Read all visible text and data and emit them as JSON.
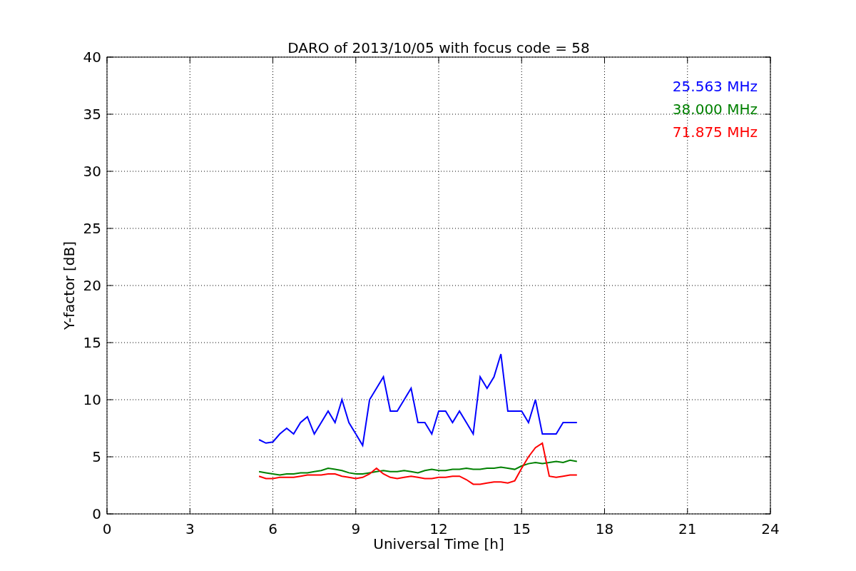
{
  "chart_data": {
    "type": "line",
    "title": "DARO of 2013/10/05 with focus code = 58",
    "xlabel": "Universal Time [h]",
    "ylabel": "Y-factor [dB]",
    "x": [
      5.5,
      5.75,
      6,
      6.25,
      6.5,
      6.75,
      7,
      7.25,
      7.5,
      7.75,
      8,
      8.25,
      8.5,
      8.75,
      9,
      9.25,
      9.5,
      9.75,
      10,
      10.25,
      10.5,
      10.75,
      11,
      11.25,
      11.5,
      11.75,
      12,
      12.25,
      12.5,
      12.75,
      13,
      13.25,
      13.5,
      13.75,
      14,
      14.25,
      14.5,
      14.75,
      15,
      15.25,
      15.5,
      15.75,
      16,
      16.25,
      16.5,
      16.75,
      17
    ],
    "series": [
      {
        "name": "25.563 MHz",
        "color": "#0000ff",
        "values": [
          6.5,
          6.2,
          6.3,
          7,
          7.5,
          7,
          8,
          8.5,
          7,
          8,
          9,
          8,
          10,
          8,
          7,
          6,
          10,
          11,
          12,
          9,
          9,
          10,
          11,
          8,
          8,
          7,
          9,
          9,
          8,
          9,
          8,
          7,
          12,
          11,
          12,
          14,
          9,
          9,
          9,
          8,
          10,
          7,
          7,
          7,
          8,
          8,
          8
        ]
      },
      {
        "name": "38.000 MHz",
        "color": "#008000",
        "values": [
          3.7,
          3.6,
          3.5,
          3.4,
          3.5,
          3.5,
          3.6,
          3.6,
          3.7,
          3.8,
          4,
          3.9,
          3.8,
          3.6,
          3.5,
          3.5,
          3.6,
          3.7,
          3.8,
          3.7,
          3.7,
          3.8,
          3.7,
          3.6,
          3.8,
          3.9,
          3.8,
          3.8,
          3.9,
          3.9,
          4,
          3.9,
          3.9,
          4,
          4,
          4.1,
          4,
          3.9,
          4.2,
          4.4,
          4.5,
          4.4,
          4.5,
          4.6,
          4.5,
          4.7,
          4.6
        ]
      },
      {
        "name": "71.875 MHz",
        "color": "#ff0000",
        "values": [
          3.3,
          3.1,
          3.1,
          3.2,
          3.2,
          3.2,
          3.3,
          3.4,
          3.4,
          3.4,
          3.5,
          3.5,
          3.3,
          3.2,
          3.1,
          3.2,
          3.5,
          4,
          3.5,
          3.2,
          3.1,
          3.2,
          3.3,
          3.2,
          3.1,
          3.1,
          3.2,
          3.2,
          3.3,
          3.3,
          3,
          2.6,
          2.6,
          2.7,
          2.8,
          2.8,
          2.7,
          2.9,
          4,
          5,
          5.8,
          6.2,
          3.3,
          3.2,
          3.3,
          3.4,
          3.4
        ]
      }
    ],
    "xlim": [
      0,
      24
    ],
    "ylim": [
      0,
      40
    ],
    "xticks": [
      0,
      3,
      6,
      9,
      12,
      15,
      18,
      21,
      24
    ],
    "yticks": [
      0,
      5,
      10,
      15,
      20,
      25,
      30,
      35,
      40
    ],
    "grid": true
  }
}
